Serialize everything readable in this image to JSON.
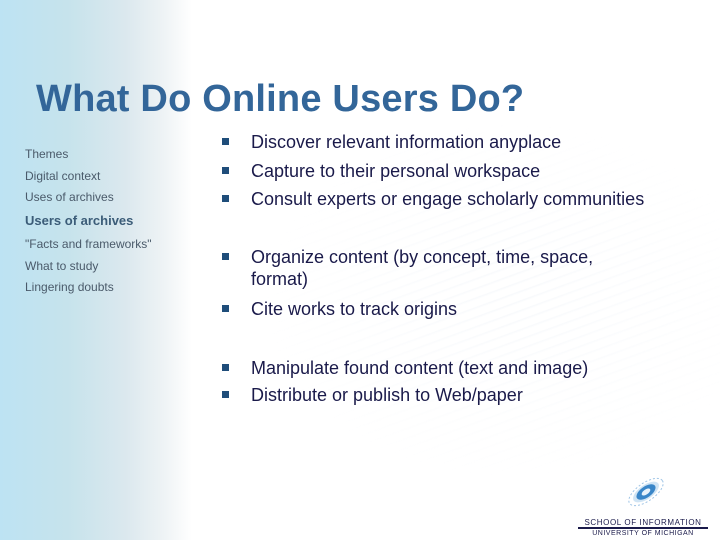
{
  "slide": {
    "title": "What Do Online Users Do?"
  },
  "sidebar": {
    "items": [
      {
        "label": "Themes",
        "active": false
      },
      {
        "label": "Digital context",
        "active": false
      },
      {
        "label": "Uses of archives",
        "active": false
      },
      {
        "label": "Users of archives",
        "active": true
      },
      {
        "label": "\"Facts and frameworks\"",
        "active": false
      },
      {
        "label": "What to study",
        "active": false
      },
      {
        "label": "Lingering doubts",
        "active": false
      }
    ]
  },
  "bullets": [
    {
      "text": "Discover relevant information anyplace"
    },
    {
      "text": "Capture to their personal workspace"
    },
    {
      "text": "Consult experts or engage scholarly communities"
    },
    {
      "text": "Organize content (by concept, time, space, format)"
    },
    {
      "text": "Cite works to track origins"
    },
    {
      "text": "Manipulate found content (text and image)"
    },
    {
      "text": "Distribute or publish to Web/paper"
    }
  ],
  "logo": {
    "icon": "galaxy-logo-icon",
    "line1": "SCHOOL OF INFORMATION",
    "line2": "UNIVERSITY OF MICHIGAN"
  },
  "colors": {
    "title": "#336699",
    "bullet_text": "#1a1a4a",
    "bullet_marker": "#1f4d7a",
    "sidebar_gradient_start": "#bde3f3"
  }
}
